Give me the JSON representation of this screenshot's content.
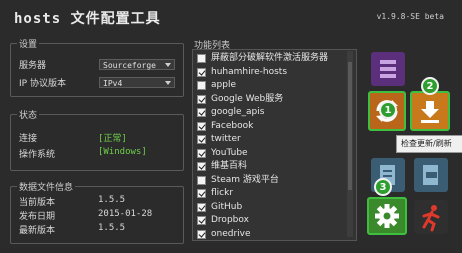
{
  "app": {
    "title": "hosts 文件配置工具",
    "version": "v1.9.8-SE beta"
  },
  "settings": {
    "title": "设置",
    "server_label": "服务器",
    "server_value": "Sourceforge",
    "ip_label": "IP 协议版本",
    "ip_value": "IPv4"
  },
  "status": {
    "title": "状态",
    "connect_label": "连接",
    "connect_value": "[正常]",
    "os_label": "操作系统",
    "os_value": "[Windows]"
  },
  "datafile": {
    "title": "数据文件信息",
    "current_label": "当前版本",
    "current_value": "1.5.5",
    "date_label": "发布日期",
    "date_value": "2015-01-28",
    "latest_label": "最新版本",
    "latest_value": "1.5.5"
  },
  "functions": {
    "title": "功能列表",
    "items": [
      {
        "label": "屏蔽部分破解软件激活服务器",
        "checked": false
      },
      {
        "label": "huhamhire-hosts",
        "checked": true
      },
      {
        "label": "apple",
        "checked": false
      },
      {
        "label": "Google Web服务",
        "checked": true
      },
      {
        "label": "google_apis",
        "checked": true
      },
      {
        "label": "Facebook",
        "checked": true
      },
      {
        "label": "twitter",
        "checked": true
      },
      {
        "label": "YouTube",
        "checked": true
      },
      {
        "label": "维基百科",
        "checked": true
      },
      {
        "label": "Steam 游戏平台",
        "checked": false
      },
      {
        "label": "flickr",
        "checked": true
      },
      {
        "label": "GitHub",
        "checked": true
      },
      {
        "label": "Dropbox",
        "checked": true
      },
      {
        "label": "onedrive",
        "checked": true
      }
    ]
  },
  "annotations": {
    "badge1": "1",
    "badge2": "2",
    "badge3": "3"
  },
  "tooltip": "检查更新/刷新"
}
